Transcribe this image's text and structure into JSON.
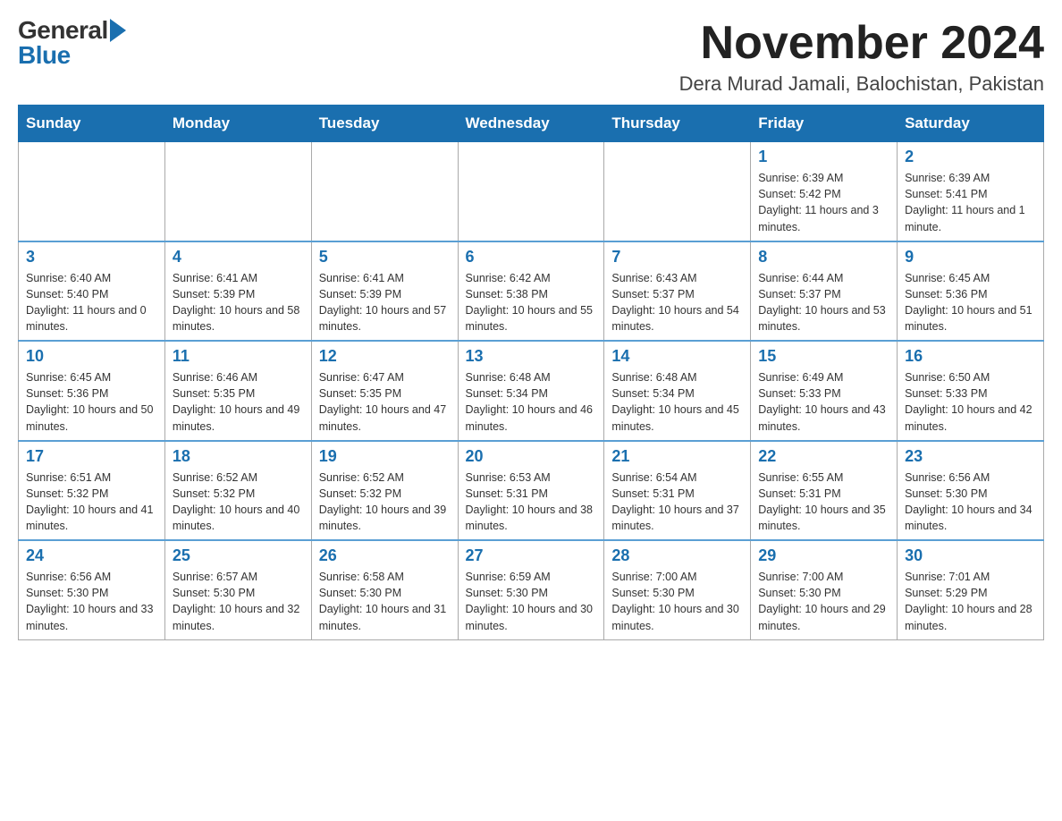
{
  "header": {
    "logo_general": "General",
    "logo_blue": "Blue",
    "month_year": "November 2024",
    "location": "Dera Murad Jamali, Balochistan, Pakistan"
  },
  "days_of_week": [
    "Sunday",
    "Monday",
    "Tuesday",
    "Wednesday",
    "Thursday",
    "Friday",
    "Saturday"
  ],
  "weeks": [
    [
      {
        "day": "",
        "info": ""
      },
      {
        "day": "",
        "info": ""
      },
      {
        "day": "",
        "info": ""
      },
      {
        "day": "",
        "info": ""
      },
      {
        "day": "",
        "info": ""
      },
      {
        "day": "1",
        "info": "Sunrise: 6:39 AM\nSunset: 5:42 PM\nDaylight: 11 hours and 3 minutes."
      },
      {
        "day": "2",
        "info": "Sunrise: 6:39 AM\nSunset: 5:41 PM\nDaylight: 11 hours and 1 minute."
      }
    ],
    [
      {
        "day": "3",
        "info": "Sunrise: 6:40 AM\nSunset: 5:40 PM\nDaylight: 11 hours and 0 minutes."
      },
      {
        "day": "4",
        "info": "Sunrise: 6:41 AM\nSunset: 5:39 PM\nDaylight: 10 hours and 58 minutes."
      },
      {
        "day": "5",
        "info": "Sunrise: 6:41 AM\nSunset: 5:39 PM\nDaylight: 10 hours and 57 minutes."
      },
      {
        "day": "6",
        "info": "Sunrise: 6:42 AM\nSunset: 5:38 PM\nDaylight: 10 hours and 55 minutes."
      },
      {
        "day": "7",
        "info": "Sunrise: 6:43 AM\nSunset: 5:37 PM\nDaylight: 10 hours and 54 minutes."
      },
      {
        "day": "8",
        "info": "Sunrise: 6:44 AM\nSunset: 5:37 PM\nDaylight: 10 hours and 53 minutes."
      },
      {
        "day": "9",
        "info": "Sunrise: 6:45 AM\nSunset: 5:36 PM\nDaylight: 10 hours and 51 minutes."
      }
    ],
    [
      {
        "day": "10",
        "info": "Sunrise: 6:45 AM\nSunset: 5:36 PM\nDaylight: 10 hours and 50 minutes."
      },
      {
        "day": "11",
        "info": "Sunrise: 6:46 AM\nSunset: 5:35 PM\nDaylight: 10 hours and 49 minutes."
      },
      {
        "day": "12",
        "info": "Sunrise: 6:47 AM\nSunset: 5:35 PM\nDaylight: 10 hours and 47 minutes."
      },
      {
        "day": "13",
        "info": "Sunrise: 6:48 AM\nSunset: 5:34 PM\nDaylight: 10 hours and 46 minutes."
      },
      {
        "day": "14",
        "info": "Sunrise: 6:48 AM\nSunset: 5:34 PM\nDaylight: 10 hours and 45 minutes."
      },
      {
        "day": "15",
        "info": "Sunrise: 6:49 AM\nSunset: 5:33 PM\nDaylight: 10 hours and 43 minutes."
      },
      {
        "day": "16",
        "info": "Sunrise: 6:50 AM\nSunset: 5:33 PM\nDaylight: 10 hours and 42 minutes."
      }
    ],
    [
      {
        "day": "17",
        "info": "Sunrise: 6:51 AM\nSunset: 5:32 PM\nDaylight: 10 hours and 41 minutes."
      },
      {
        "day": "18",
        "info": "Sunrise: 6:52 AM\nSunset: 5:32 PM\nDaylight: 10 hours and 40 minutes."
      },
      {
        "day": "19",
        "info": "Sunrise: 6:52 AM\nSunset: 5:32 PM\nDaylight: 10 hours and 39 minutes."
      },
      {
        "day": "20",
        "info": "Sunrise: 6:53 AM\nSunset: 5:31 PM\nDaylight: 10 hours and 38 minutes."
      },
      {
        "day": "21",
        "info": "Sunrise: 6:54 AM\nSunset: 5:31 PM\nDaylight: 10 hours and 37 minutes."
      },
      {
        "day": "22",
        "info": "Sunrise: 6:55 AM\nSunset: 5:31 PM\nDaylight: 10 hours and 35 minutes."
      },
      {
        "day": "23",
        "info": "Sunrise: 6:56 AM\nSunset: 5:30 PM\nDaylight: 10 hours and 34 minutes."
      }
    ],
    [
      {
        "day": "24",
        "info": "Sunrise: 6:56 AM\nSunset: 5:30 PM\nDaylight: 10 hours and 33 minutes."
      },
      {
        "day": "25",
        "info": "Sunrise: 6:57 AM\nSunset: 5:30 PM\nDaylight: 10 hours and 32 minutes."
      },
      {
        "day": "26",
        "info": "Sunrise: 6:58 AM\nSunset: 5:30 PM\nDaylight: 10 hours and 31 minutes."
      },
      {
        "day": "27",
        "info": "Sunrise: 6:59 AM\nSunset: 5:30 PM\nDaylight: 10 hours and 30 minutes."
      },
      {
        "day": "28",
        "info": "Sunrise: 7:00 AM\nSunset: 5:30 PM\nDaylight: 10 hours and 30 minutes."
      },
      {
        "day": "29",
        "info": "Sunrise: 7:00 AM\nSunset: 5:30 PM\nDaylight: 10 hours and 29 minutes."
      },
      {
        "day": "30",
        "info": "Sunrise: 7:01 AM\nSunset: 5:29 PM\nDaylight: 10 hours and 28 minutes."
      }
    ]
  ]
}
